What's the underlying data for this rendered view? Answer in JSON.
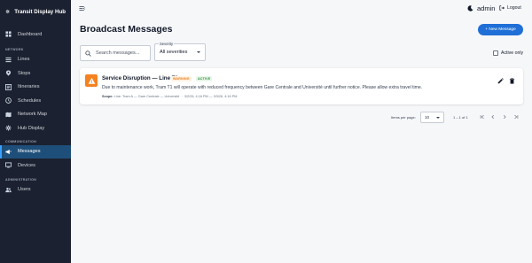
{
  "app": {
    "name": "Transit Display Hub"
  },
  "sidebar": {
    "items": [
      {
        "label": "Dashboard",
        "icon": "grid-icon"
      }
    ],
    "network_section": "NETWORK",
    "network_items": [
      {
        "label": "Lines",
        "icon": "list-icon"
      },
      {
        "label": "Stops",
        "icon": "pin-icon"
      },
      {
        "label": "Itineraries",
        "icon": "route-icon"
      },
      {
        "label": "Schedules",
        "icon": "clock-icon"
      },
      {
        "label": "Network Map",
        "icon": "map-icon"
      },
      {
        "label": "Hub Display",
        "icon": "hub-icon"
      }
    ],
    "communication_section": "COMMUNICATION",
    "communication_items": [
      {
        "label": "Messages",
        "icon": "megaphone-icon",
        "active": true
      },
      {
        "label": "Devices",
        "icon": "monitor-icon"
      }
    ],
    "administration_section": "ADMINISTRATION",
    "administration_items": [
      {
        "label": "Users",
        "icon": "users-icon"
      }
    ]
  },
  "topbar": {
    "user": "admin",
    "logout_label": "Logout"
  },
  "page": {
    "title": "Broadcast Messages",
    "new_button_label": "+ New Message"
  },
  "filters": {
    "search_placeholder": "Search messages...",
    "severity_label": "Severity",
    "severity_value": "All severities",
    "active_only_label": "Active only"
  },
  "messages": [
    {
      "title": "Service Disruption — Line T1",
      "severity": "WARNING",
      "status": "ACTIVE",
      "body": "Due to maintenance work, Tram T1 will operate with reduced frequency between Gare Centrale and Université until further notice. Please allow extra travel time.",
      "scope_label": "Scope:",
      "scope": "Line: Tram A — Gare Centrale — Université",
      "date_range": "3/2/26, 4:16 PM — 3/3/26, 4:16 PM"
    }
  ],
  "pagination": {
    "items_per_page_label": "Items per page:",
    "items_per_page": "10",
    "range": "1 – 1 of 1"
  },
  "colors": {
    "sidebar_bg": "#1b2130",
    "accent": "#1f6fd6",
    "warning": "#f58220",
    "active": "#2f8f3a"
  }
}
